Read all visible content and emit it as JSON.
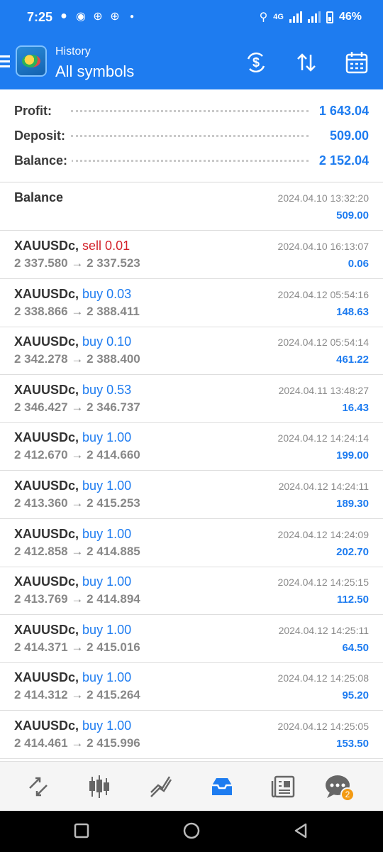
{
  "status_bar": {
    "time": "7:25",
    "network": "4G",
    "battery": "46%",
    "notification_icons": [
      "snapchat-icon",
      "chat-icon",
      "app-icon",
      "app-icon",
      "dot-icon"
    ]
  },
  "app_bar": {
    "subtitle": "History",
    "title": "All symbols",
    "actions": [
      "dollar-refresh-icon",
      "sort-icon",
      "calendar-icon"
    ]
  },
  "summary": {
    "profit_label": "Profit:",
    "profit_value": "1 643.04",
    "deposit_label": "Deposit:",
    "deposit_value": "509.00",
    "balance_label": "Balance:",
    "balance_value": "2 152.04"
  },
  "balance_entry": {
    "label": "Balance",
    "date": "2024.04.10 13:32:20",
    "amount": "509.00"
  },
  "deals": [
    {
      "symbol": "XAUUSDc,",
      "side": "sell 0.01",
      "type": "sell",
      "open": "2 337.580",
      "close": "2 337.523",
      "date": "2024.04.10 16:13:07",
      "profit": "0.06"
    },
    {
      "symbol": "XAUUSDc,",
      "side": "buy 0.03",
      "type": "buy",
      "open": "2 338.866",
      "close": "2 388.411",
      "date": "2024.04.12 05:54:16",
      "profit": "148.63"
    },
    {
      "symbol": "XAUUSDc,",
      "side": "buy 0.10",
      "type": "buy",
      "open": "2 342.278",
      "close": "2 388.400",
      "date": "2024.04.12 05:54:14",
      "profit": "461.22"
    },
    {
      "symbol": "XAUUSDc,",
      "side": "buy 0.53",
      "type": "buy",
      "open": "2 346.427",
      "close": "2 346.737",
      "date": "2024.04.11 13:48:27",
      "profit": "16.43"
    },
    {
      "symbol": "XAUUSDc,",
      "side": "buy 1.00",
      "type": "buy",
      "open": "2 412.670",
      "close": "2 414.660",
      "date": "2024.04.12 14:24:14",
      "profit": "199.00"
    },
    {
      "symbol": "XAUUSDc,",
      "side": "buy 1.00",
      "type": "buy",
      "open": "2 413.360",
      "close": "2 415.253",
      "date": "2024.04.12 14:24:11",
      "profit": "189.30"
    },
    {
      "symbol": "XAUUSDc,",
      "side": "buy 1.00",
      "type": "buy",
      "open": "2 412.858",
      "close": "2 414.885",
      "date": "2024.04.12 14:24:09",
      "profit": "202.70"
    },
    {
      "symbol": "XAUUSDc,",
      "side": "buy 1.00",
      "type": "buy",
      "open": "2 413.769",
      "close": "2 414.894",
      "date": "2024.04.12 14:25:15",
      "profit": "112.50"
    },
    {
      "symbol": "XAUUSDc,",
      "side": "buy 1.00",
      "type": "buy",
      "open": "2 414.371",
      "close": "2 415.016",
      "date": "2024.04.12 14:25:11",
      "profit": "64.50"
    },
    {
      "symbol": "XAUUSDc,",
      "side": "buy 1.00",
      "type": "buy",
      "open": "2 414.312",
      "close": "2 415.264",
      "date": "2024.04.12 14:25:08",
      "profit": "95.20"
    },
    {
      "symbol": "XAUUSDc,",
      "side": "buy 1.00",
      "type": "buy",
      "open": "2 414.461",
      "close": "2 415.996",
      "date": "2024.04.12 14:25:05",
      "profit": "153.50"
    }
  ],
  "arrow": "→",
  "tab_bar": {
    "tabs": [
      "quotes-icon",
      "chart-icon",
      "trade-icon",
      "history-icon",
      "news-icon",
      "messages-icon"
    ],
    "active_tab": "history-icon",
    "messages_badge": "2"
  },
  "colors": {
    "accent": "#1e7cf0",
    "sell": "#d3222a",
    "badge": "#f39a12"
  }
}
